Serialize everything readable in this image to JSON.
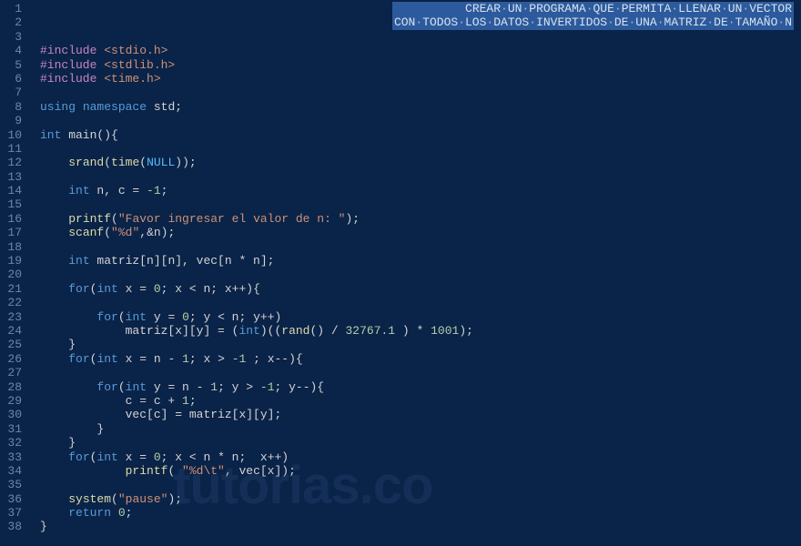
{
  "gutter": {
    "start": 1,
    "end": 38
  },
  "header_comment": {
    "line1_words": [
      "CREAR",
      "UN",
      "PROGRAMA",
      "QUE",
      "PERMITA",
      "LLENAR",
      "UN",
      "VECTOR"
    ],
    "line2_words": [
      "CON",
      "TODOS",
      "LOS",
      "DATOS",
      "INVERTIDOS",
      "DE",
      "UNA",
      "MATRIZ",
      "DE",
      "TAMAÑO",
      "N"
    ]
  },
  "code": {
    "l4_preproc": "#include ",
    "l4_path": "<stdio.h>",
    "l5_preproc": "#include ",
    "l5_path": "<stdlib.h>",
    "l6_preproc": "#include ",
    "l6_path": "<time.h>",
    "l8_using": "using",
    "l8_namespace": "namespace",
    "l8_std": " std;",
    "l10_int": "int",
    "l10_main": " main",
    "l12_srand": "srand",
    "l12_time": "time",
    "l12_null": "NULL",
    "l14_int": "int",
    "l14_decl": " n, c = ",
    "l14_neg1": "-1",
    "l16_printf": "printf",
    "l16_str": "\"Favor ingresar el valor de n: \"",
    "l17_scanf": "scanf",
    "l17_fmt": "\"%d\"",
    "l17_arg": ",&n);",
    "l19_int": "int",
    "l19_decl": " matriz[n][n], vec[n * n];",
    "l21_for": "for",
    "l21_int": "int",
    "l21_cond": " x = ",
    "l21_zero": "0",
    "l21_rest": "; x < n; x++){",
    "l23_for": "for",
    "l23_int": "int",
    "l23_cond": " y = ",
    "l23_zero": "0",
    "l23_rest": "; y < n; y++)",
    "l24_assign": "matriz[x][y] = (",
    "l24_int": "int",
    "l24_mid": ")((",
    "l24_rand": "rand",
    "l24_mid2": "() / ",
    "l24_num1": "32767.1",
    "l24_mid3": " ) * ",
    "l24_num2": "1001",
    "l24_end": ");",
    "l26_for": "for",
    "l26_int": "int",
    "l26_cond": " x = n - ",
    "l26_one": "1",
    "l26_mid": "; x > ",
    "l26_neg1": "-1",
    "l26_rest": " ; x--){",
    "l28_for": "for",
    "l28_int": "int",
    "l28_cond": " y = n - ",
    "l28_one": "1",
    "l28_mid": "; y > ",
    "l28_neg1": "-1",
    "l28_rest": "; y--){",
    "l29_assign": "c = c + ",
    "l29_one": "1",
    "l30_assign": "vec[c] = matriz[x][y];",
    "l33_for": "for",
    "l33_int": "int",
    "l33_cond": " x = ",
    "l33_zero": "0",
    "l33_rest": "; x < n * n;  x++)",
    "l34_printf": "printf",
    "l34_fmt": "\"%d\\t\"",
    "l34_arg": ", vec[x]);",
    "l36_system": "system",
    "l36_str": "\"pause\"",
    "l37_return": "return",
    "l37_zero": "0"
  },
  "watermark": "tutorias.co"
}
